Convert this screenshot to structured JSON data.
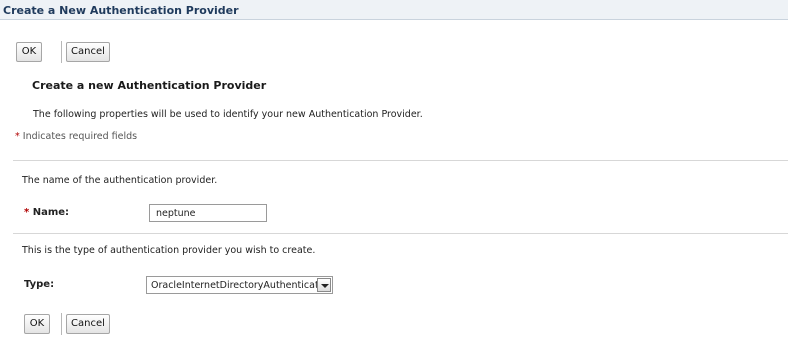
{
  "header": {
    "title": "Create a New Authentication Provider"
  },
  "toolbar_top": {
    "ok_label": "OK",
    "cancel_label": "Cancel"
  },
  "section": {
    "title": "Create a new Authentication Provider",
    "description": "The following properties will be used to identify your new Authentication Provider.",
    "required_note_marker": "*",
    "required_note": "Indicates required fields"
  },
  "name_field": {
    "help_text": "The name of the authentication provider.",
    "required_marker": "*",
    "label": "Name:",
    "value": "neptune"
  },
  "type_field": {
    "help_text": "This is the type of authentication provider you wish to create.",
    "label": "Type:",
    "selected": "OracleInternetDirectoryAuthenticator",
    "dropdown_icon": "chevron-down-icon"
  },
  "toolbar_bottom": {
    "ok_label": "OK",
    "cancel_label": "Cancel"
  }
}
